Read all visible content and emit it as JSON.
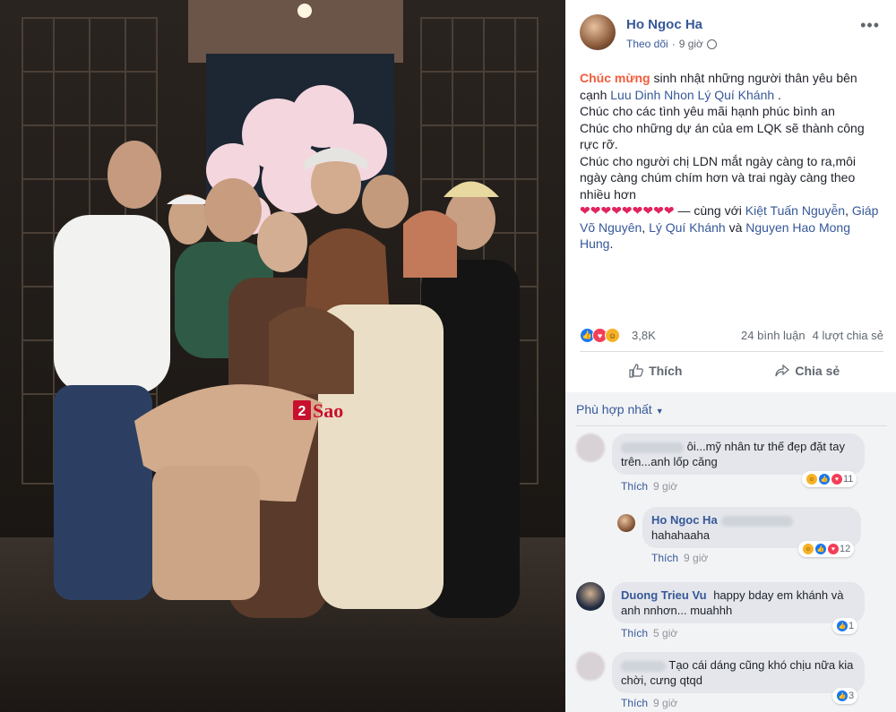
{
  "post": {
    "author": "Ho Ngoc Ha",
    "follow_label": "Theo dõi",
    "time": "9 giờ",
    "body": {
      "congrats": "Chúc mừng",
      "line1": " sinh nhật những người thân yêu bên cạnh ",
      "tag1": "Luu Dinh Nhon",
      "tag2": "Lý Quí Khánh",
      "line1_end": " .",
      "line2": "Chúc cho các tình yêu mãi hạnh phúc bình an",
      "line3": "Chúc cho những dự án của em LQK sẽ thành công rực rỡ.",
      "line4": "Chúc cho người chị LDN mắt ngày càng to ra,môi ngày càng chúm chím hơn và trai ngày càng theo nhiều hơn",
      "hearts": "❤❤❤❤❤❤❤❤❤",
      "with_prefix": " — cùng với ",
      "with1": "Kiệt Tuấn Nguyễn",
      "with2": "Giáp Võ Nguyên",
      "with3": "Lý Quí Khánh",
      "and": " và ",
      "with4": "Nguyen Hao Mong Hung",
      "comma": ", ",
      "period": "."
    },
    "reaction_count": "3,8K",
    "comments_count": "24 bình luận",
    "shares_count": "4 lượt chia sẻ",
    "like_label": "Thích",
    "share_label": "Chia sẻ",
    "sort_label": "Phù hợp nhất",
    "watermark": "2Sao"
  },
  "comments": [
    {
      "name": "",
      "text": "ôi...mỹ nhân tư thế đẹp đặt tay trên...anh lốp căng",
      "like": "Thích",
      "time": "9 giờ",
      "reactions": "11"
    },
    {
      "name": "Ho Ngoc Ha",
      "text": "hahahaaha",
      "like": "Thích",
      "time": "9 giờ",
      "reactions": "12"
    },
    {
      "name": "Duong Trieu Vu",
      "text": "happy bday em khánh và anh nnhơn... muahhh",
      "like": "Thích",
      "time": "5 giờ",
      "reactions": "1"
    },
    {
      "name": "",
      "text": "Tạo cái dáng cũng khó chịu nữa kia chời, cưng qtqd",
      "like": "Thích",
      "time": "9 giờ",
      "reactions": "3"
    }
  ],
  "colors": {
    "link": "#365899",
    "accent": "#f25c3a",
    "like_blue": "#1877f2",
    "love_red": "#f33e58"
  }
}
